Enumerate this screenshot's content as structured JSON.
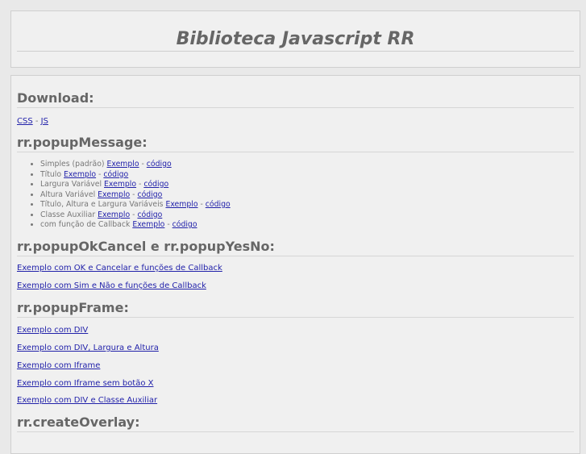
{
  "header": {
    "title": "Biblioteca Javascript RR"
  },
  "download": {
    "heading": "Download:",
    "css_label": "CSS",
    "sep": " - ",
    "js_label": "JS"
  },
  "popupMessage": {
    "heading": "rr.popupMessage:",
    "items": [
      {
        "text": "Simples (padrão)",
        "example": "Exemplo",
        "sep": " - ",
        "code": "código"
      },
      {
        "text": "Título",
        "example": "Exemplo",
        "sep": " - ",
        "code": "código"
      },
      {
        "text": "Largura Variável",
        "example": "Exemplo",
        "sep": " - ",
        "code": "código"
      },
      {
        "text": "Altura Variável",
        "example": "Exemplo",
        "sep": " - ",
        "code": "código"
      },
      {
        "text": "Título, Altura e Largura Variáveis",
        "example": "Exemplo",
        "sep": " - ",
        "code": "código"
      },
      {
        "text": "Classe Auxiliar",
        "example": "Exemplo",
        "sep": " - ",
        "code": "código"
      },
      {
        "text": "com função de Callback",
        "example": "Exemplo",
        "sep": " - ",
        "code": "código"
      }
    ]
  },
  "popupOkCancel": {
    "heading": "rr.popupOkCancel e rr.popupYesNo:",
    "links": [
      "Exemplo com OK e Cancelar e funções de Callback",
      "Exemplo com Sim e Não e funções de Callback"
    ]
  },
  "popupFrame": {
    "heading": "rr.popupFrame:",
    "links": [
      "Exemplo com DIV",
      "Exemplo com DIV, Largura e Altura",
      "Exemplo com Iframe",
      "Exemplo com Iframe sem botão X",
      "Exemplo com DIV e Classe Auxiliar"
    ]
  },
  "createOverlay": {
    "heading": "rr.createOverlay:"
  }
}
